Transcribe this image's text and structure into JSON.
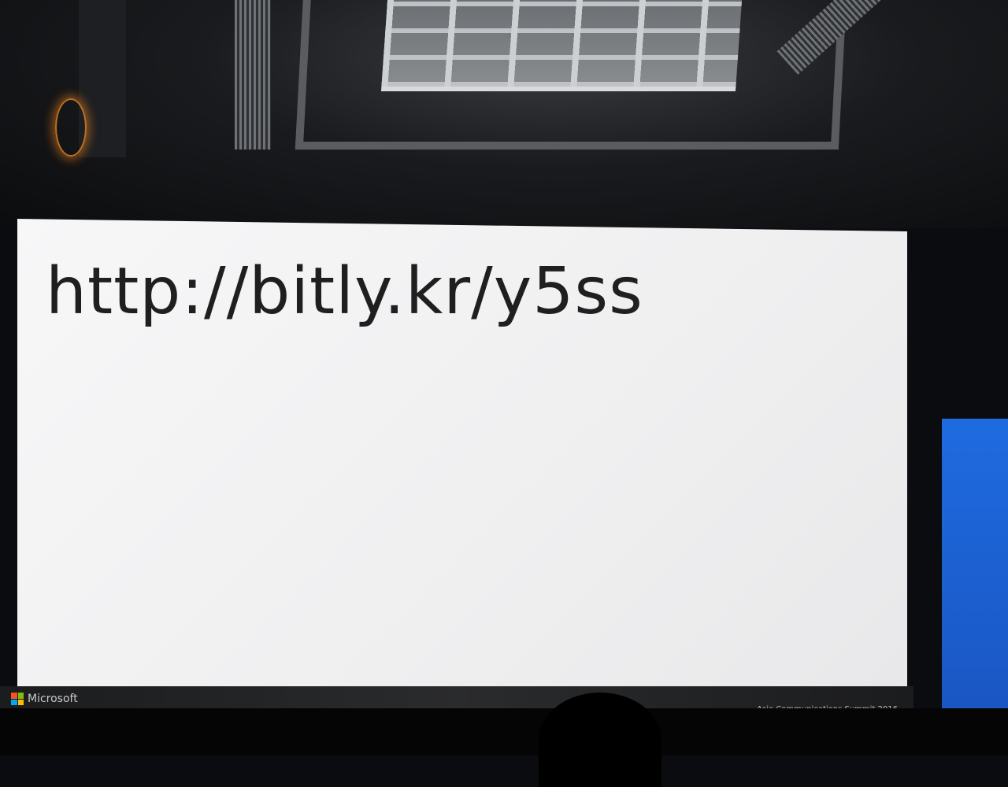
{
  "slide": {
    "url_text": "http://bitly.kr/y5ss"
  },
  "footer": {
    "brand_label": "Microsoft",
    "event_label": "Asia Communications Summit 2016",
    "logo_colors": [
      "#f35325",
      "#81bc06",
      "#05a6f0",
      "#ffba08"
    ]
  },
  "icons": {
    "brand": "microsoft-logo-icon"
  }
}
